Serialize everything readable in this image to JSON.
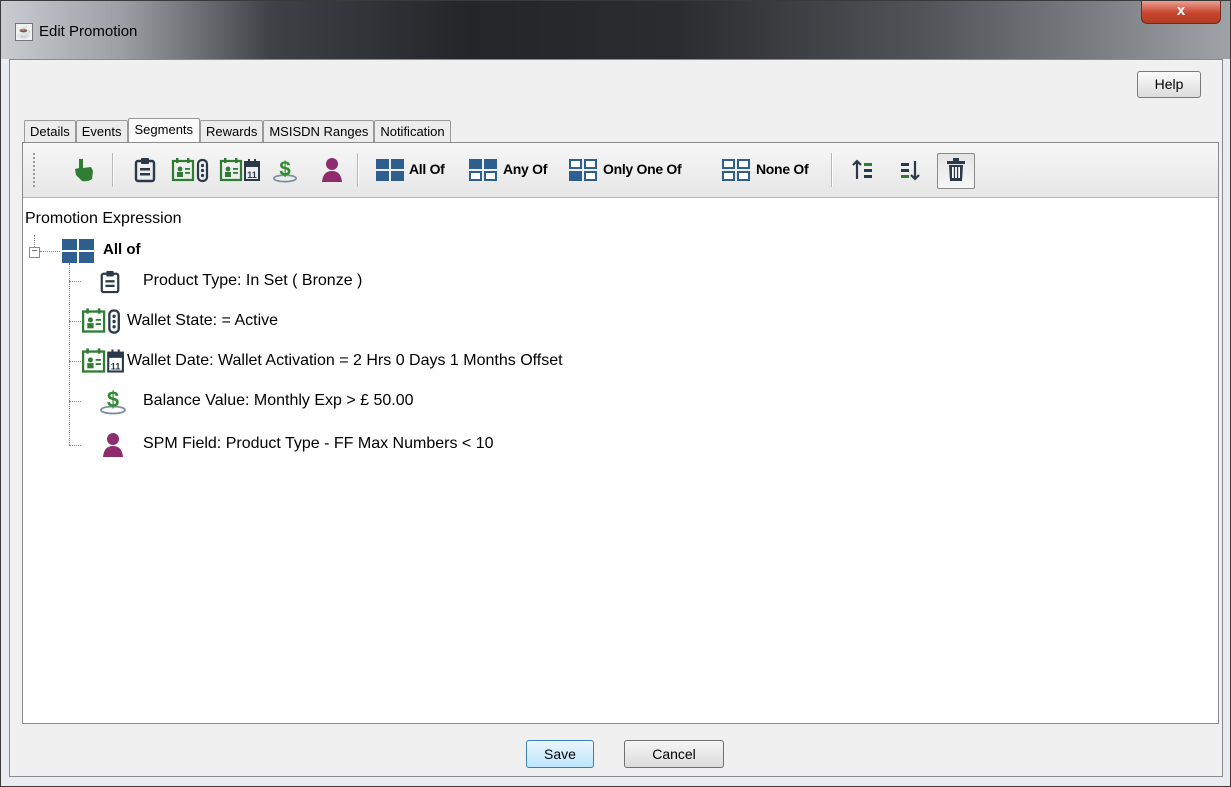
{
  "window": {
    "title": "Edit Promotion",
    "close_label": "x"
  },
  "header": {
    "help_label": "Help"
  },
  "tabs": [
    {
      "label": "Details"
    },
    {
      "label": "Events"
    },
    {
      "label": "Segments",
      "active": true
    },
    {
      "label": "Rewards"
    },
    {
      "label": "MSISDN Ranges"
    },
    {
      "label": "Notification"
    }
  ],
  "toolbar": {
    "icons": [
      "pointer-hand-icon",
      "product-type-icon",
      "wallet-state-icon",
      "wallet-date-icon",
      "balance-value-icon",
      "spm-field-icon",
      "all-of-icon",
      "any-of-icon",
      "only-one-of-icon",
      "none-of-icon",
      "move-up-icon",
      "move-down-icon",
      "delete-icon"
    ],
    "all_of_label": "All Of",
    "any_of_label": "Any Of",
    "only_one_of_label": "Only One Of",
    "none_of_label": "None Of"
  },
  "tree": {
    "title": "Promotion Expression",
    "root_label": "All of",
    "items": [
      {
        "icon": "product-type-icon",
        "text": "Product Type:  In Set  ( Bronze  )"
      },
      {
        "icon": "wallet-state-icon",
        "text": "Wallet State:  = Active"
      },
      {
        "icon": "wallet-date-icon",
        "text": "Wallet Date:  Wallet Activation =  2 Hrs  0 Days  1 Months  Offset"
      },
      {
        "icon": "balance-value-icon",
        "text": "Balance Value:  Monthly Exp  >  £ 50.00"
      },
      {
        "icon": "spm-field-icon",
        "text": "SPM Field:  Product Type - FF Max Numbers  <  10"
      }
    ]
  },
  "footer": {
    "save_label": "Save",
    "cancel_label": "Cancel"
  },
  "colors": {
    "grid_blue": "#2f5f8f",
    "green": "#2e7d32",
    "money_green": "#2e8b2e",
    "person_purple": "#8e2c6e"
  }
}
